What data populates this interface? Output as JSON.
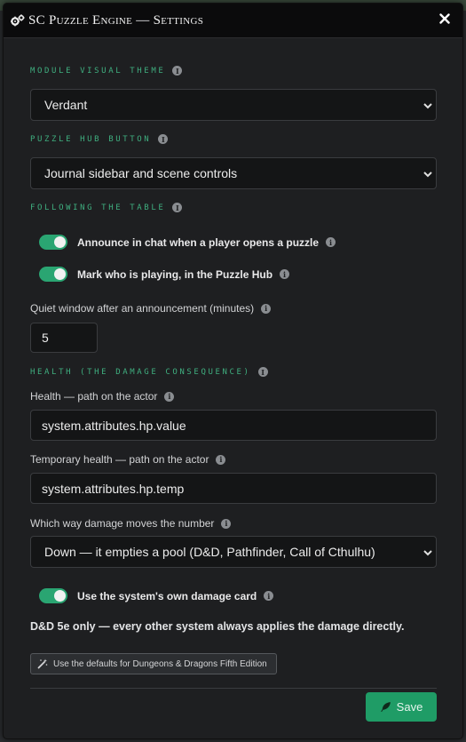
{
  "window": {
    "title": "SC Puzzle Engine — Settings",
    "title_icon": "gears-icon",
    "close_icon": "close-icon"
  },
  "visual_theme": {
    "label": "Module Visual Theme",
    "value": "Verdant"
  },
  "hub_button": {
    "label": "Puzzle Hub Button",
    "value": "Journal sidebar and scene controls"
  },
  "following": {
    "label": "Following the Table",
    "toggles": [
      {
        "label": "Announce in chat when a player opens a puzzle",
        "on": true
      },
      {
        "label": "Mark who is playing, in the Puzzle Hub",
        "on": true
      }
    ],
    "quiet_label": "Quiet window after an announcement (minutes)",
    "quiet_value": "5"
  },
  "health": {
    "label": "Health (the damage consequence)",
    "path_label": "Health — path on the actor",
    "path_value": "system.attributes.hp.value",
    "temp_label": "Temporary health — path on the actor",
    "temp_value": "system.attributes.hp.temp",
    "direction_label": "Which way damage moves the number",
    "direction_value": "Down — it empties a pool (D&D, Pathfinder, Call of Cthulhu)",
    "damage_card_label": "Use the system's own damage card",
    "damage_card_on": true,
    "note": "D&D 5e only — every other system always applies the damage directly.",
    "defaults_button": "Use the defaults for Dungeons & Dragons Fifth Edition"
  },
  "footer": {
    "save_label": "Save"
  },
  "colors": {
    "accent": "#3fae7f",
    "toggle_on": "#2aa572",
    "save_bg": "#1f9c66"
  }
}
